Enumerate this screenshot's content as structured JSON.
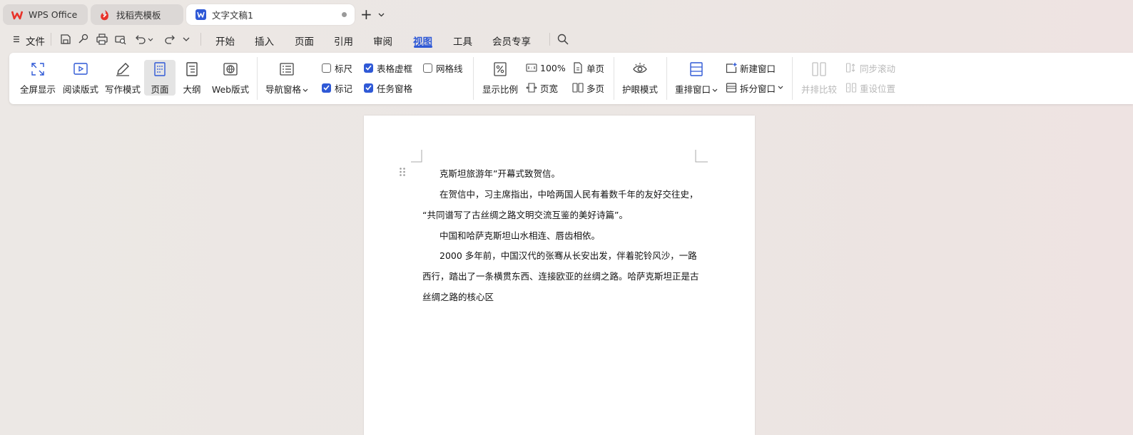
{
  "tabs": [
    {
      "label": "WPS Office"
    },
    {
      "label": "找稻壳模板"
    },
    {
      "label": "文字文稿1"
    }
  ],
  "menu": {
    "file": "文件",
    "items": [
      "开始",
      "插入",
      "页面",
      "引用",
      "审阅",
      "视图",
      "工具",
      "会员专享"
    ],
    "active": "视图"
  },
  "ribbon": {
    "fullscreen": "全屏显示",
    "reading": "阅读版式",
    "writing": "写作模式",
    "page": "页面",
    "outline": "大纲",
    "web": "Web版式",
    "nav_pane": "导航窗格",
    "ruler": "标尺",
    "table_grid": "表格虚框",
    "gridlines": "网格线",
    "marks": "标记",
    "task_pane": "任务窗格",
    "zoom": "显示比例",
    "zoom100": "100%",
    "page_width": "页宽",
    "single_page": "单页",
    "multi_page": "多页",
    "eye_care": "护眼模式",
    "arrange": "重排窗口",
    "new_window": "新建窗口",
    "split_window": "拆分窗口",
    "side_by_side": "并排比较",
    "sync_scroll": "同步滚动",
    "reset_position": "重设位置"
  },
  "checkboxes": {
    "ruler": false,
    "table_grid": true,
    "gridlines": false,
    "marks": true,
    "task_pane": true
  },
  "doc": {
    "lines": [
      "克斯坦旅游年”开幕式致贺信。",
      "在贺信中，习主席指出，中哈两国人民有着数千年的友好交往史，",
      "“共同谱写了古丝绸之路文明交流互鉴的美好诗篇”。",
      "中国和哈萨克斯坦山水相连、唇齿相依。",
      "2000 多年前，中国汉代的张骞从长安出发，伴着驼铃风沙，一路",
      "西行，踏出了一条横贯东西、连接欧亚的丝绸之路。哈萨克斯坦正是古",
      "丝绸之路的核心区"
    ]
  },
  "colors": {
    "accent": "#2f59d6",
    "wps_red": "#e8332a"
  }
}
